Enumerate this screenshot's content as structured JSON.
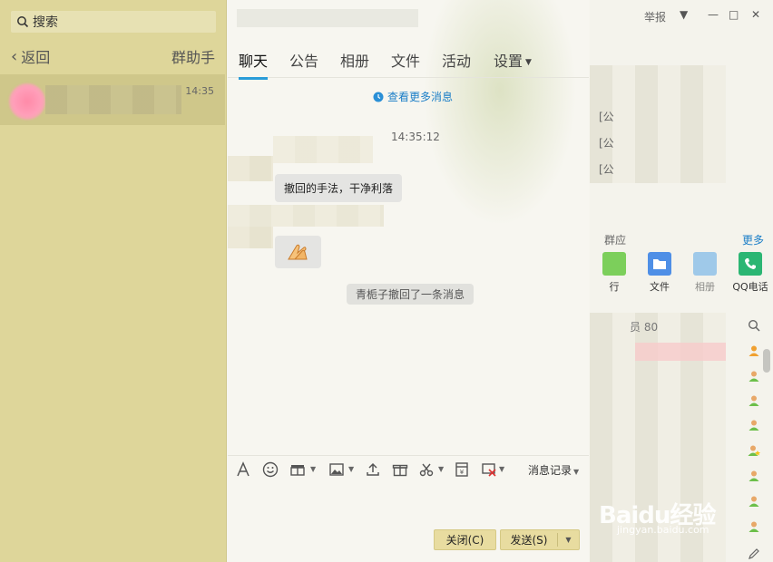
{
  "sidebar": {
    "search_placeholder": "搜索",
    "back_label": "返回",
    "group_helper_label": "群助手",
    "conversation": {
      "time": "14:35"
    }
  },
  "header": {
    "report_label": "举报"
  },
  "tabs": [
    "聊天",
    "公告",
    "相册",
    "文件",
    "活动",
    "设置"
  ],
  "chat": {
    "load_more": "查看更多消息",
    "timestamp": "14:35:12",
    "message_text": "撤回的手法，干净利落",
    "message_emoji": "🙏",
    "recall_notice": "青栀子撤回了一条消息"
  },
  "toolbar": {
    "history_label": "消息记录",
    "icons": [
      "font-icon",
      "emoji-icon",
      "gift-icon",
      "image-icon",
      "upload-icon",
      "gift-box-icon",
      "scissors-icon",
      "red-packet-icon",
      "screen-share-icon"
    ]
  },
  "actions": {
    "close_label": "关闭(C)",
    "send_label": "发送(S)"
  },
  "right_panel": {
    "announcement_prefixes": [
      "[公",
      "[公",
      "[公"
    ],
    "apps_title": "群应",
    "apps_more": "更多",
    "apps": [
      {
        "label": "行",
        "color": "#6cc24a"
      },
      {
        "label": "文件",
        "color": "#4f8fe6"
      },
      {
        "label": "相册",
        "color": "#5aa8e8"
      },
      {
        "label": "QQ电话",
        "color": "#2bb673"
      }
    ],
    "members_header": "员 80"
  },
  "watermark": {
    "brand": "Baidu经验",
    "url": "jingyan.baidu.com"
  }
}
